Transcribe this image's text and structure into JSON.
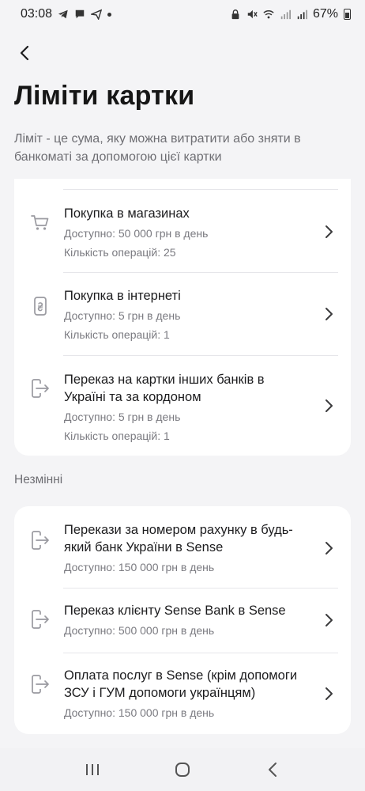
{
  "status_bar": {
    "time": "03:08",
    "battery": "67%"
  },
  "header": {
    "title": "Ліміти картки",
    "description": "Ліміт - це сума, яку можна витратити або зняти в банкоматі за допомогою цієї картки"
  },
  "editable_limits": [
    {
      "title": "Покупка в магазинах",
      "available": "Доступно: 50 000 грн в день",
      "operations": "Кількість операцій: 25",
      "icon": "cart-icon"
    },
    {
      "title": "Покупка в інтернеті",
      "available": "Доступно: 5 грн в день",
      "operations": "Кількість операцій: 1",
      "icon": "phone-hryvnia-icon"
    },
    {
      "title": "Переказ на картки інших банків в Україні та за кордоном",
      "available": "Доступно: 5 грн в день",
      "operations": "Кількість операцій: 1",
      "icon": "transfer-out-icon"
    }
  ],
  "fixed_section": {
    "label": "Незмінні",
    "items": [
      {
        "title": "Перекази за номером рахунку в будь-який банк України в Sense",
        "available": "Доступно: 150 000 грн в день",
        "icon": "transfer-out-icon"
      },
      {
        "title": "Переказ клієнту Sense Bank в Sense",
        "available": "Доступно: 500 000 грн в день",
        "icon": "transfer-out-icon"
      },
      {
        "title": "Оплата послуг в Sense (крім допомоги ЗСУ і ГУМ допомоги українцям)",
        "available": "Доступно: 150 000 грн в день",
        "icon": "transfer-out-icon"
      }
    ]
  },
  "colors": {
    "background": "#f4f4f6",
    "card": "#ffffff",
    "text": "#1c1c1e",
    "muted": "#7a7a80"
  }
}
